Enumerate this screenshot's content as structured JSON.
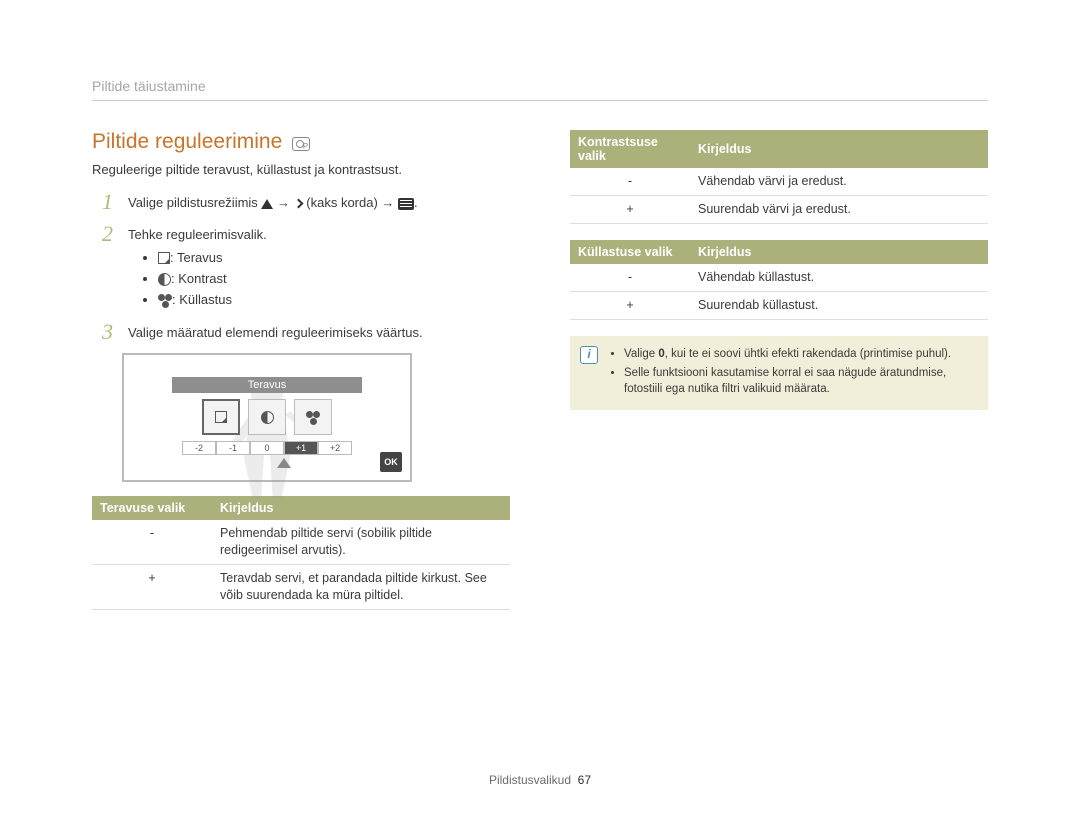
{
  "breadcrumb": "Piltide täiustamine",
  "heading": "Piltide reguleerimine",
  "intro": "Reguleerige piltide teravust, küllastust ja kontrastsust.",
  "steps": {
    "s1_pre": "Valige pildistusrežiimis ",
    "s1_mid": " (kaks korda) ",
    "s2": "Tehke reguleerimisvalik.",
    "s2_items": {
      "a": ": Teravus",
      "b": ": Kontrast",
      "c": ": Küllastus"
    },
    "s3": "Valige määratud elemendi reguleerimiseks väärtus."
  },
  "mock": {
    "label": "Teravus",
    "scale": [
      "-2",
      "-1",
      "0",
      "+1",
      "+2"
    ],
    "ok": "OK"
  },
  "table_teravus": {
    "h1": "Teravuse valik",
    "h2": "Kirjeldus",
    "rows": [
      {
        "sym": "-",
        "desc": "Pehmendab piltide servi (sobilik piltide redigeerimisel arvutis)."
      },
      {
        "sym": "+",
        "desc": "Teravdab servi, et parandada piltide kirkust. See võib suurendada ka müra piltidel."
      }
    ]
  },
  "table_kontrast": {
    "h1": "Kontrastsuse valik",
    "h2": "Kirjeldus",
    "rows": [
      {
        "sym": "-",
        "desc": "Vähendab värvi ja eredust."
      },
      {
        "sym": "+",
        "desc": "Suurendab värvi ja eredust."
      }
    ]
  },
  "table_kyllastus": {
    "h1": "Küllastuse valik",
    "h2": "Kirjeldus",
    "rows": [
      {
        "sym": "-",
        "desc": "Vähendab küllastust."
      },
      {
        "sym": "+",
        "desc": "Suurendab küllastust."
      }
    ]
  },
  "note": {
    "item1_pre": "Valige ",
    "item1_bold": "0",
    "item1_post": ", kui te ei soovi ühtki efekti rakendada (printimise puhul).",
    "item2": "Selle funktsiooni kasutamise korral ei saa nägude äratundmise, fotostiili ega nutika filtri valikuid määrata."
  },
  "footer": {
    "section": "Pildistusvalikud",
    "page": "67"
  }
}
